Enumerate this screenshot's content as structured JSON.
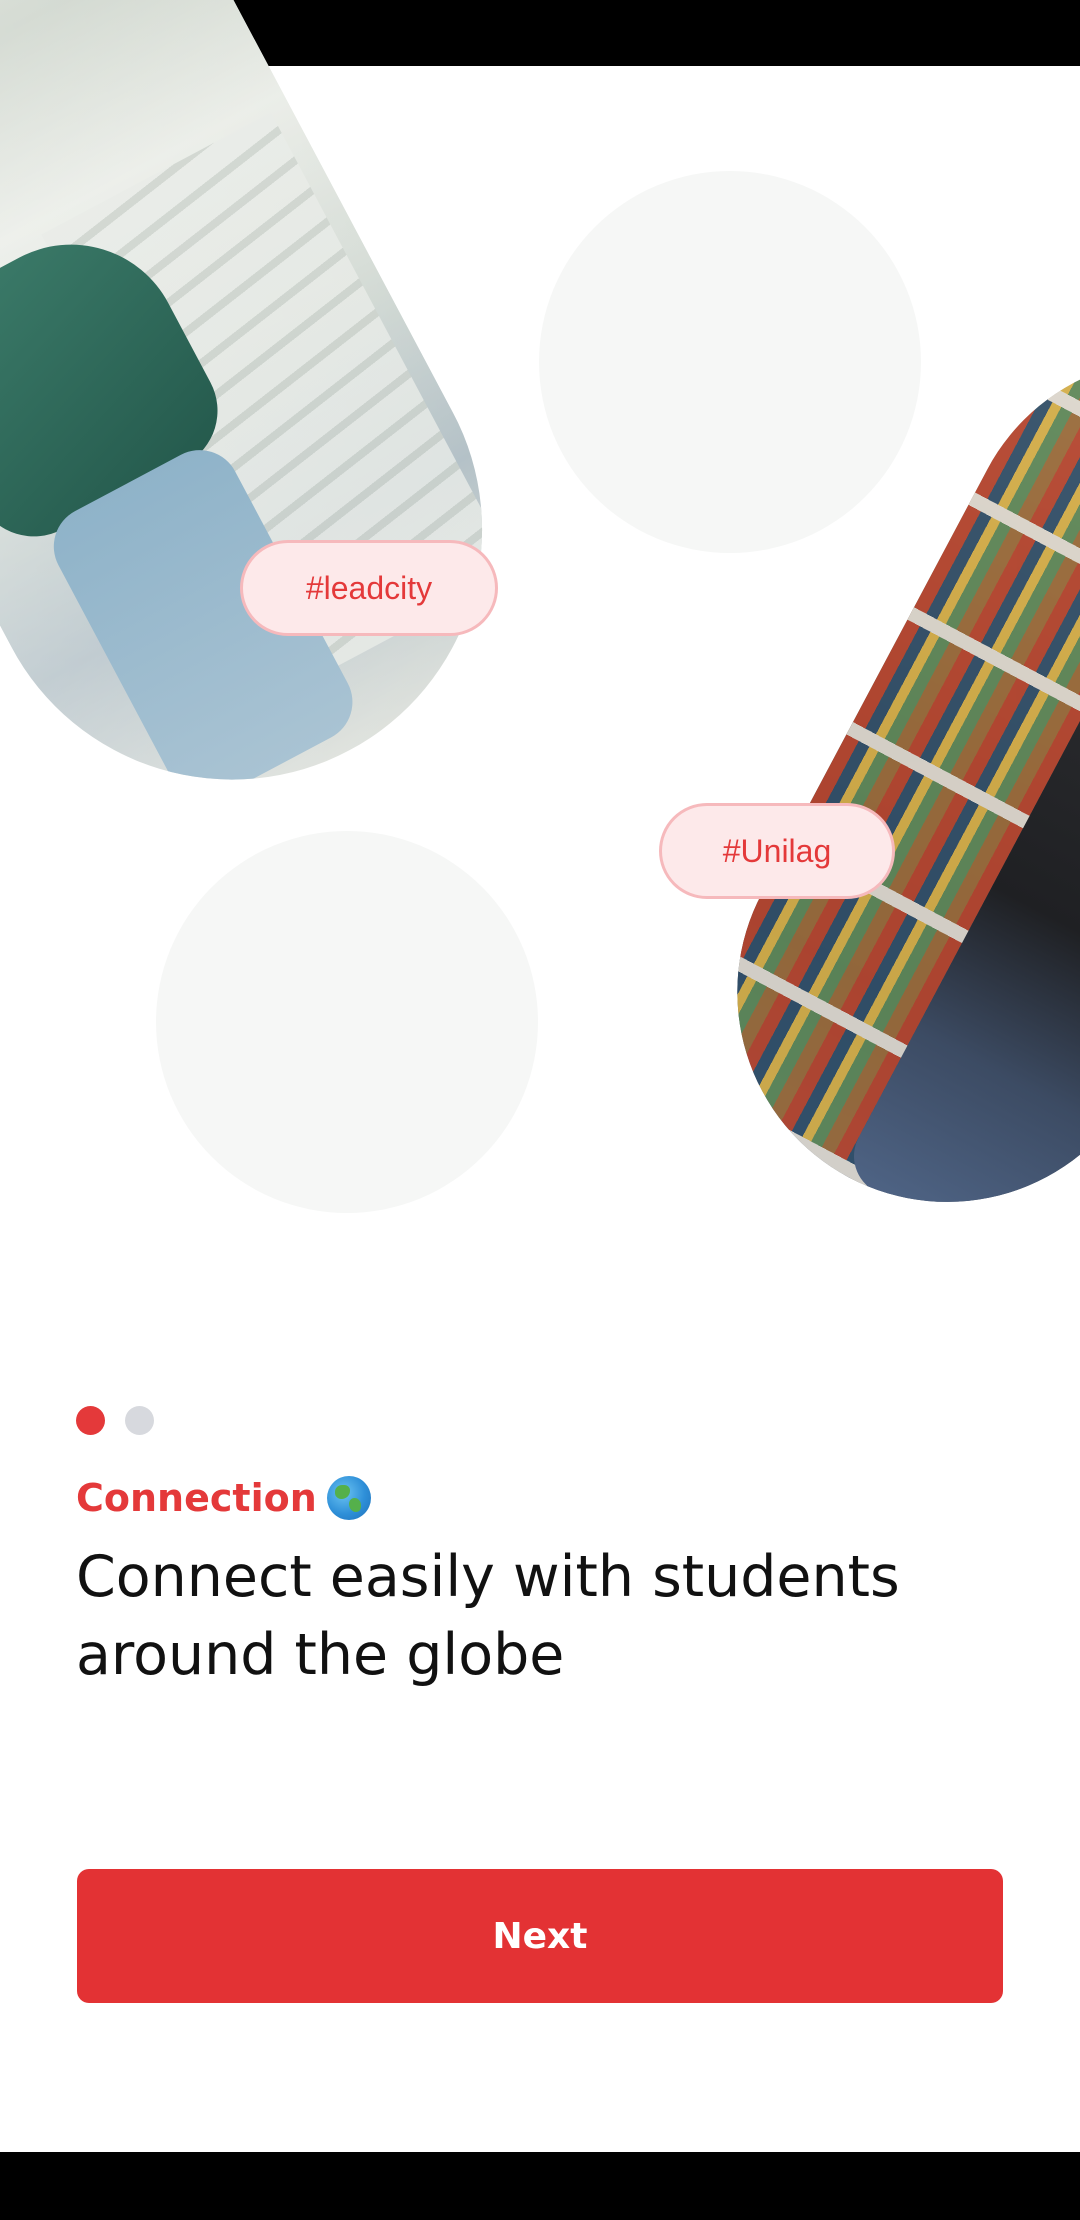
{
  "onboarding": {
    "tags": [
      "#leadcity",
      "#Unilag"
    ],
    "pager": {
      "total": 2,
      "active_index": 0
    },
    "eyebrow": "Connection",
    "eyebrow_icon": "globe-icon",
    "headline": "Connect easily with students around the globe",
    "next_label": "Next"
  },
  "colors": {
    "accent": "#e4393a",
    "button": "#e33234",
    "tag_bg": "#fde9ea",
    "tag_border": "#f6b9bc",
    "dot_inactive": "#d7d9de",
    "headline": "#111111"
  }
}
